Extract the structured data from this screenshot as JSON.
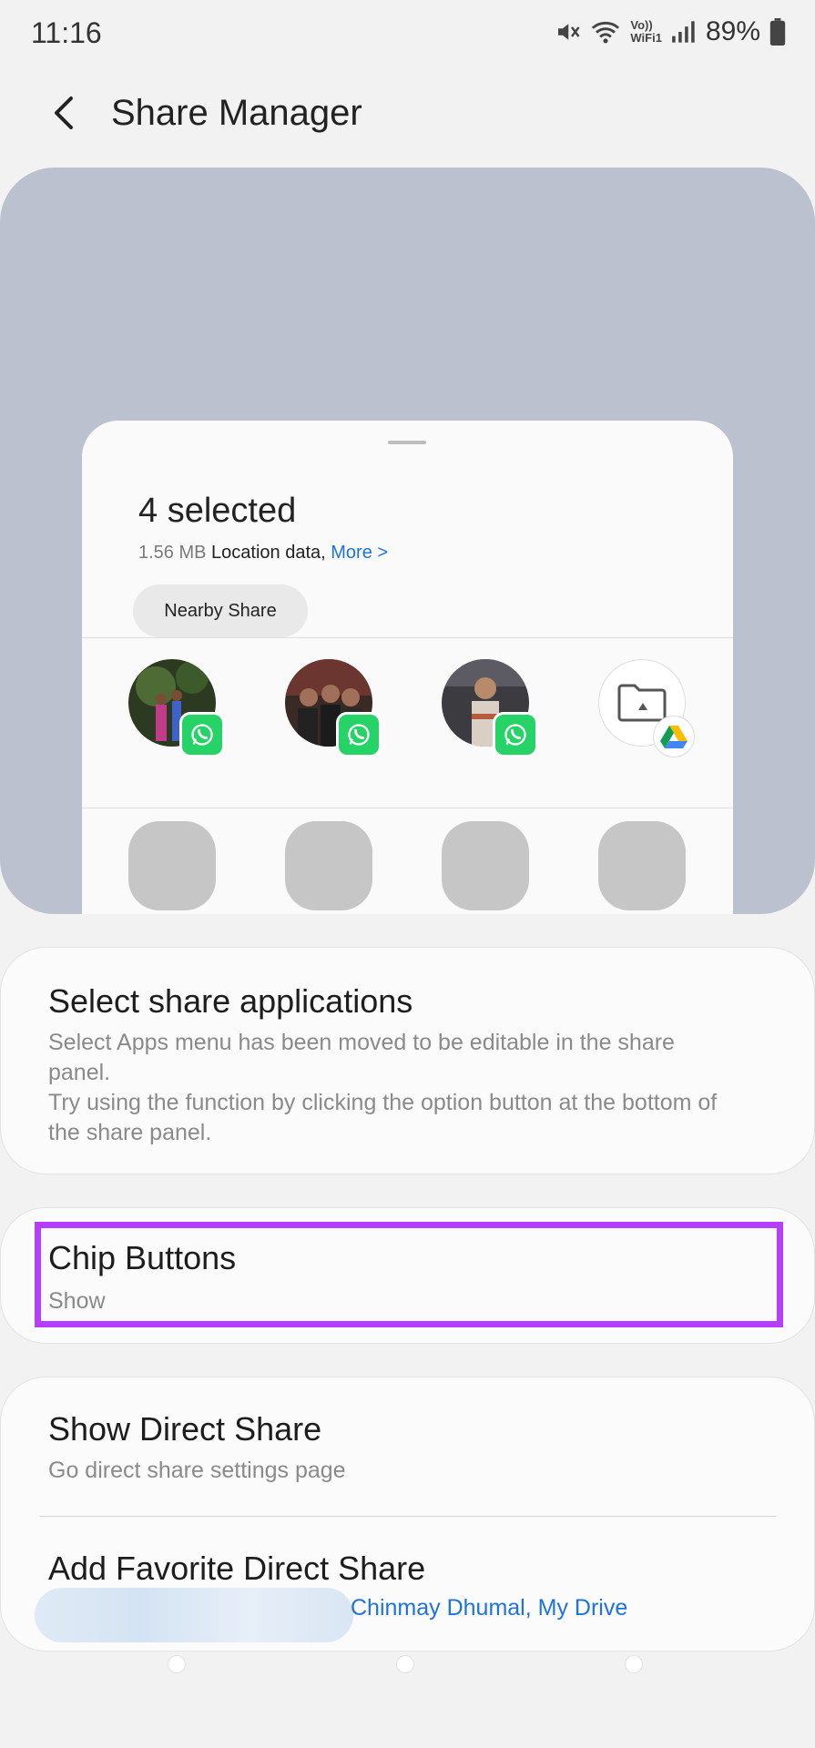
{
  "status": {
    "time": "11:16",
    "battery": "89%",
    "wifi_call_line1": "Vo))",
    "wifi_call_line2": "WiFi1",
    "icons": [
      "mute-icon",
      "wifi-icon",
      "wifi-calling-icon",
      "signal-icon",
      "battery-icon"
    ]
  },
  "header": {
    "title": "Share Manager",
    "back_icon": "chevron-left-icon"
  },
  "preview": {
    "selected_title": "4 selected",
    "size": "1.56 MB",
    "location_text": "Location data,",
    "more_link": "More >",
    "chip_label": "Nearby Share",
    "direct_targets": [
      {
        "type": "contact",
        "app": "whatsapp-icon"
      },
      {
        "type": "contact",
        "app": "whatsapp-icon"
      },
      {
        "type": "contact",
        "app": "whatsapp-icon"
      },
      {
        "type": "folder",
        "app": "google-drive-icon"
      }
    ],
    "placeholder_count": 4
  },
  "settings": {
    "select_apps": {
      "title": "Select share applications",
      "desc": "Select Apps menu has been moved to be editable in the share panel.\nTry using the function by clicking the option button at the bottom of the share panel."
    },
    "chip_buttons": {
      "title": "Chip Buttons",
      "value": "Show"
    },
    "direct_share": {
      "title": "Show Direct Share",
      "desc": "Go direct share settings page"
    },
    "favorite_direct_share": {
      "title": "Add Favorite Direct Share",
      "value": "Chinmay Dhumal, My Drive"
    }
  },
  "colors": {
    "highlight": "#b43fff",
    "link": "#1d73e0",
    "whatsapp": "#25d366",
    "preview_bg": "#bbc1ce"
  }
}
